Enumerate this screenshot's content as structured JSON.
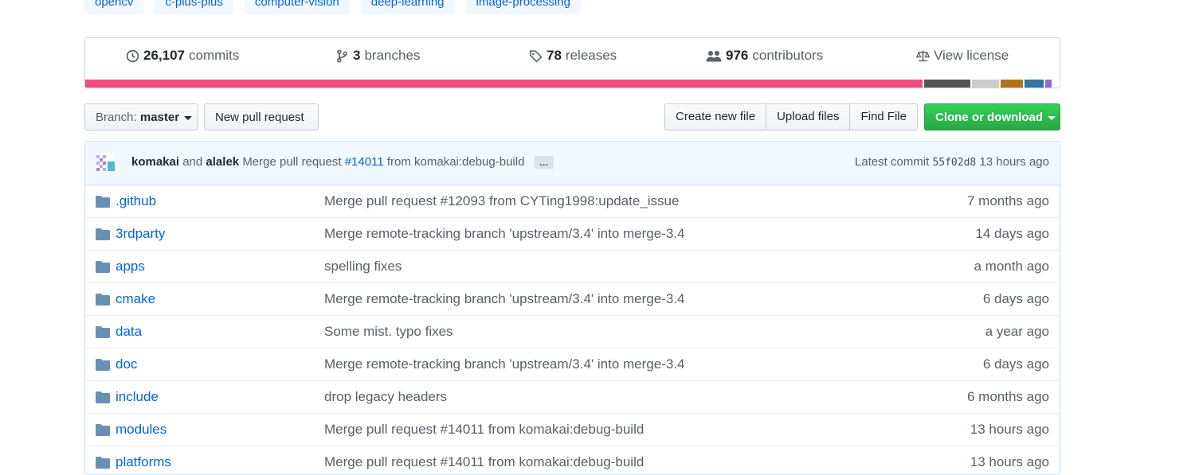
{
  "topics": [
    "opencv",
    "c-plus-plus",
    "computer-vision",
    "deep-learning",
    "image-processing"
  ],
  "stats": {
    "commits": {
      "count": "26,107",
      "label": "commits",
      "icon": "history-icon"
    },
    "branches": {
      "count": "3",
      "label": "branches",
      "icon": "branch-icon"
    },
    "releases": {
      "count": "78",
      "label": "releases",
      "icon": "tag-icon"
    },
    "contributors": {
      "count": "976",
      "label": "contributors",
      "icon": "people-icon"
    },
    "license": {
      "label": "View license",
      "icon": "law-icon"
    }
  },
  "language_bar": [
    {
      "color": "#f34b7d",
      "fraction": 0.868
    },
    {
      "color": "#555555",
      "fraction": 0.048
    },
    {
      "color": "#cccccc",
      "fraction": 0.028
    },
    {
      "color": "#b07219",
      "fraction": 0.023
    },
    {
      "color": "#3572a5",
      "fraction": 0.02
    },
    {
      "color": "#8a6ce0",
      "fraction": 0.006
    },
    {
      "color": "#ffffff",
      "fraction": 0.007
    }
  ],
  "toolbar": {
    "branch_prefix": "Branch:",
    "branch_name": "master",
    "new_pull_request": "New pull request",
    "create_new_file": "Create new file",
    "upload_files": "Upload files",
    "find_file": "Find File",
    "clone_or_download": "Clone or download"
  },
  "commit": {
    "author1": "komakai",
    "and": "and",
    "author2": "alalek",
    "message_prefix": "Merge pull request",
    "pr_link": "#14011",
    "message_suffix": "from komakai:debug-build",
    "ellipsis": "…",
    "latest_label": "Latest commit",
    "sha": "55f02d8",
    "time": "13 hours ago"
  },
  "files": [
    {
      "name": ".github",
      "message": "Merge pull request #12093 from CYTing1998:update_issue",
      "age": "7 months ago"
    },
    {
      "name": "3rdparty",
      "message": "Merge remote-tracking branch 'upstream/3.4' into merge-3.4",
      "age": "14 days ago"
    },
    {
      "name": "apps",
      "message": "spelling fixes",
      "age": "a month ago"
    },
    {
      "name": "cmake",
      "message": "Merge remote-tracking branch 'upstream/3.4' into merge-3.4",
      "age": "6 days ago"
    },
    {
      "name": "data",
      "message": "Some mist. typo fixes",
      "age": "a year ago"
    },
    {
      "name": "doc",
      "message": "Merge remote-tracking branch 'upstream/3.4' into merge-3.4",
      "age": "6 days ago"
    },
    {
      "name": "include",
      "message": "drop legacy headers",
      "age": "6 months ago"
    },
    {
      "name": "modules",
      "message": "Merge pull request #14011 from komakai:debug-build",
      "age": "13 hours ago"
    },
    {
      "name": "platforms",
      "message": "Merge pull request #14011 from komakai:debug-build",
      "age": "13 hours ago"
    }
  ]
}
